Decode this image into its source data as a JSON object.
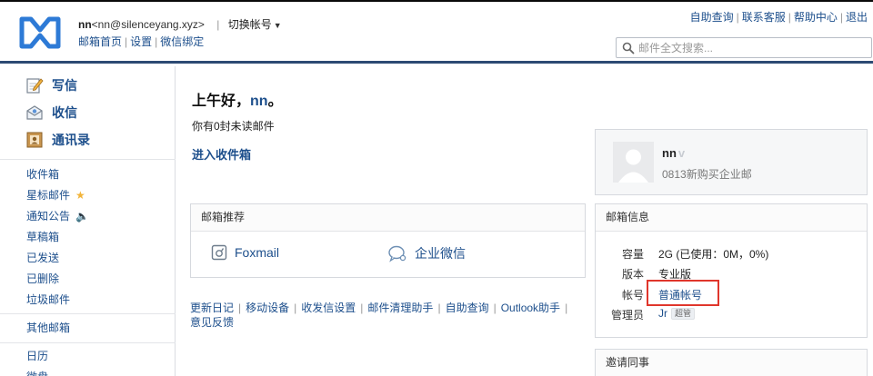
{
  "header": {
    "nickname": "nn",
    "email": "<nn@silenceyang.xyz>",
    "switch_account": "切换帐号",
    "nav": {
      "home": "邮箱首页",
      "settings": "设置",
      "wechat": "微信绑定"
    },
    "top_links": [
      "自助查询",
      "联系客服",
      "帮助中心",
      "退出"
    ],
    "search_placeholder": "邮件全文搜索..."
  },
  "sidebar": {
    "main": [
      {
        "label": "写信",
        "icon": "write-icon"
      },
      {
        "label": "收信",
        "icon": "receive-icon"
      },
      {
        "label": "通讯录",
        "icon": "contacts-icon"
      }
    ],
    "folders": [
      "收件箱",
      "星标邮件",
      "通知公告",
      "草稿箱",
      "已发送",
      "已删除",
      "垃圾邮件"
    ],
    "other": "其他邮箱",
    "calendar": "日历",
    "partial": "微盘"
  },
  "main": {
    "greeting_prefix": "上午好，",
    "greeting_name": "nn",
    "greeting_suffix": "。",
    "unread": "你有0封未读邮件",
    "inbox_link": "进入收件箱",
    "recommend_title": "邮箱推荐",
    "recommend_items": [
      "Foxmail",
      "企业微信"
    ],
    "footer_links": [
      "更新日记",
      "移动设备",
      "收发信设置",
      "邮件清理助手",
      "自助查询",
      "Outlook助手",
      "意见反馈"
    ]
  },
  "profile": {
    "name": "nn",
    "desc": "0813新购买企业邮"
  },
  "mailbox_info": {
    "title": "邮箱信息",
    "rows": [
      {
        "label": "容量",
        "value": "2G (已使用：0M，0%)"
      },
      {
        "label": "版本",
        "value": "专业版"
      },
      {
        "label": "帐号",
        "value": "普通帐号"
      },
      {
        "label": "管理员",
        "value": "Jr",
        "badge": "超管"
      }
    ]
  },
  "invite": {
    "title": "邀请同事"
  },
  "colors": {
    "brand": "#2d7ad6",
    "link": "#1d4f8c",
    "header_rule": "#2c4a73",
    "highlight": "#e0362c",
    "star": "#f2b43a"
  }
}
